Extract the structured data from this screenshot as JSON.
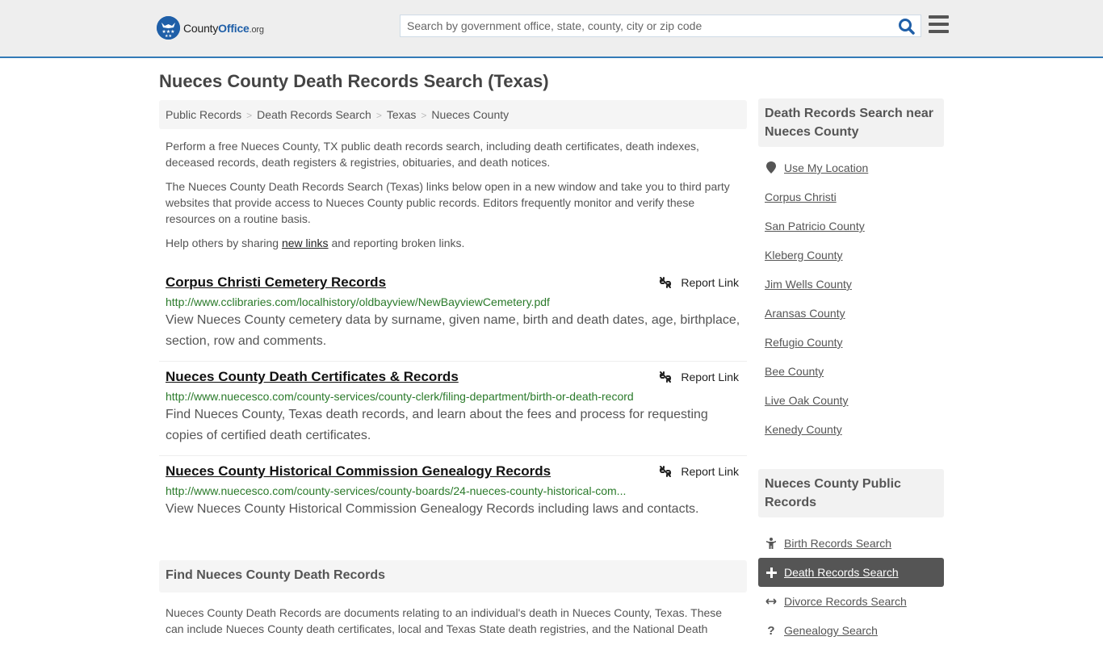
{
  "header": {
    "logo": {
      "name": "County",
      "accent": "Office",
      "tld": ".org"
    },
    "search": {
      "placeholder": "Search by government office, state, county, city or zip code",
      "value": ""
    },
    "brand_color": "#337ab7"
  },
  "page": {
    "title": "Nueces County Death Records Search (Texas)",
    "breadcrumb": [
      "Public Records",
      "Death Records Search",
      "Texas",
      "Nueces County"
    ],
    "intro": {
      "p1": "Perform a free Nueces County, TX public death records search, including death certificates, death indexes, deceased records, death registers & registries, obituaries, and death notices.",
      "p2": "The Nueces County Death Records Search (Texas) links below open in a new window and take you to third party websites that provide access to Nueces County public records. Editors frequently monitor and verify these resources on a routine basis.",
      "p3_before": "Help others by sharing ",
      "p3_link": "new links",
      "p3_after": " and reporting broken links."
    },
    "report_label": "Report Link",
    "results": [
      {
        "title": "Corpus Christi Cemetery Records",
        "url": "http://www.cclibraries.com/localhistory/oldbayview/NewBayviewCemetery.pdf",
        "description": "View Nueces County cemetery data by surname, given name, birth and death dates, age, birthplace, section, row and comments."
      },
      {
        "title": "Nueces County Death Certificates & Records",
        "url": "http://www.nuecesco.com/county-services/county-clerk/filing-department/birth-or-death-record",
        "description": "Find Nueces County, Texas death records, and learn about the fees and process for requesting copies of certified death certificates."
      },
      {
        "title": "Nueces County Historical Commission Genealogy Records",
        "url": "http://www.nuecesco.com/county-services/county-boards/24-nueces-county-historical-com...",
        "description": "View Nueces County Historical Commission Genealogy Records including laws and contacts."
      }
    ],
    "find": {
      "heading": "Find Nueces County Death Records",
      "text": "Nueces County Death Records are documents relating to an individual's death in Nueces County, Texas. These can include Nueces County death certificates, local and Texas State death registries, and the National Death"
    }
  },
  "sidebar": {
    "nearby": {
      "heading": "Death Records Search near Nueces County",
      "use_location": "Use My Location",
      "items": [
        "Corpus Christi",
        "San Patricio County",
        "Kleberg County",
        "Jim Wells County",
        "Aransas County",
        "Refugio County",
        "Bee County",
        "Live Oak County",
        "Kenedy County"
      ]
    },
    "public_records": {
      "heading": "Nueces County Public Records",
      "items": [
        {
          "label": "Birth Records Search",
          "icon": "child-icon",
          "active": false
        },
        {
          "label": "Death Records Search",
          "icon": "plus-icon",
          "active": true
        },
        {
          "label": "Divorce Records Search",
          "icon": "arrows-horizontal-icon",
          "active": false
        },
        {
          "label": "Genealogy Search",
          "icon": "question-icon",
          "active": false
        }
      ]
    }
  }
}
